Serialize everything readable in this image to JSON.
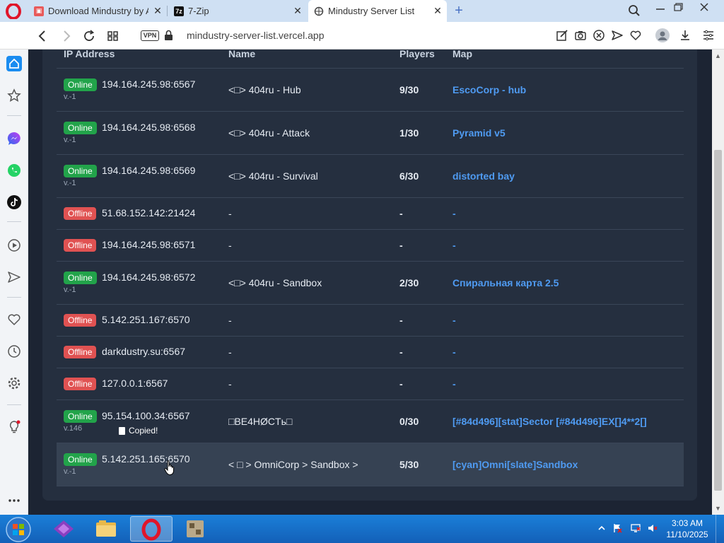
{
  "browser": {
    "tabs": [
      {
        "title": "Download Mindustry by A",
        "favicon": "itch-icon"
      },
      {
        "title": "7-Zip",
        "favicon": "7zip-icon"
      },
      {
        "title": "Mindustry Server List",
        "favicon": "globe-icon"
      }
    ],
    "url": "mindustry-server-list.vercel.app",
    "vpn_label": "VPN"
  },
  "table": {
    "headers": {
      "ip": "IP Address",
      "name": "Name",
      "players": "Players",
      "map": "Map"
    },
    "rows": [
      {
        "status": "Online",
        "ip": "194.164.245.98:6567",
        "version": "v.-1",
        "name": "<□> 404ru - Hub",
        "players": "9/30",
        "map": "EscoCorp - hub"
      },
      {
        "status": "Online",
        "ip": "194.164.245.98:6568",
        "version": "v.-1",
        "name": "<□> 404ru - Attack",
        "players": "1/30",
        "map": "Pyramid v5"
      },
      {
        "status": "Online",
        "ip": "194.164.245.98:6569",
        "version": "v.-1",
        "name": "<□> 404ru - Survival",
        "players": "6/30",
        "map": "distorted bay"
      },
      {
        "status": "Offline",
        "ip": "51.68.152.142:21424",
        "name": "-",
        "players": "-",
        "map": "-"
      },
      {
        "status": "Offline",
        "ip": "194.164.245.98:6571",
        "name": "-",
        "players": "-",
        "map": "-"
      },
      {
        "status": "Online",
        "ip": "194.164.245.98:6572",
        "version": "v.-1",
        "name": "<□> 404ru - Sandbox",
        "players": "2/30",
        "map": "Спиральная карта 2.5"
      },
      {
        "status": "Offline",
        "ip": "5.142.251.167:6570",
        "name": "-",
        "players": "-",
        "map": "-"
      },
      {
        "status": "Offline",
        "ip": "darkdustry.su:6567",
        "name": "-",
        "players": "-",
        "map": "-"
      },
      {
        "status": "Offline",
        "ip": "127.0.0.1:6567",
        "name": "-",
        "players": "-",
        "map": "-"
      },
      {
        "status": "Online",
        "ip": "95.154.100.34:6567",
        "version": "v.146",
        "copied": "Copied!",
        "name": "□BE4HØCTь□",
        "players": "0/30",
        "map": "[#84d496][stat]Sector [#84d496]EX[]4**2[]"
      },
      {
        "status": "Online",
        "ip": "5.142.251.165:6570",
        "version": "v.-1",
        "name": "< □ > OmniCorp > Sandbox >",
        "players": "5/30",
        "map": "[cyan]Omni[slate]Sandbox"
      }
    ]
  },
  "taskbar": {
    "time": "3:03 AM",
    "date": "11/10/2025"
  },
  "colors": {
    "online": "#22a34a",
    "offline": "#e05252",
    "map_link": "#4f9bf2",
    "page_bg": "#1c2433"
  }
}
